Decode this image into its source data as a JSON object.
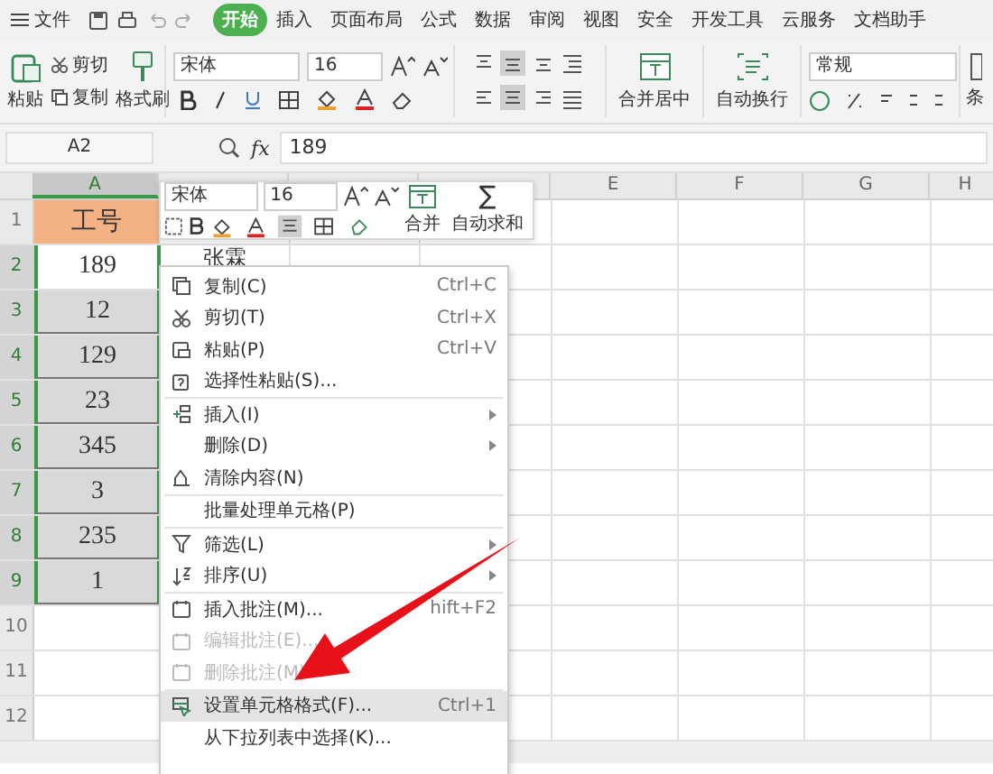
{
  "menu_bar": {
    "file": "文件",
    "tabs": [
      {
        "label": "开始",
        "selected": true
      },
      {
        "label": "插入",
        "selected": false
      },
      {
        "label": "页面布局",
        "selected": false
      },
      {
        "label": "公式",
        "selected": false
      },
      {
        "label": "数据",
        "selected": false
      },
      {
        "label": "审阅",
        "selected": false
      },
      {
        "label": "视图",
        "selected": false
      },
      {
        "label": "安全",
        "selected": false
      },
      {
        "label": "开发工具",
        "selected": false
      },
      {
        "label": "云服务",
        "selected": false
      },
      {
        "label": "文档助手",
        "selected": false
      }
    ]
  },
  "ribbon": {
    "paste": "粘贴",
    "cut": "剪切",
    "copy": "复制",
    "format_painter": "格式刷",
    "font": "宋体",
    "size": "16",
    "merge": "合并居中",
    "wrap": "自动换行",
    "number_format": "常规",
    "conditional": "条"
  },
  "formula_bar": {
    "cell_ref": "A2",
    "fx": "fx",
    "value": "189"
  },
  "sheet": {
    "columns": [
      {
        "label": "A",
        "selected": true
      },
      {
        "selected": false
      },
      {
        "selected": false
      },
      {
        "selected": false
      },
      {
        "label": "E",
        "selected": false
      },
      {
        "label": "F",
        "selected": false
      },
      {
        "label": "G",
        "selected": false
      },
      {
        "label": "H",
        "selected": false
      }
    ],
    "rows": [
      {
        "num": "1",
        "selected": false,
        "a": "工号",
        "kind": "header"
      },
      {
        "num": "2",
        "selected": true,
        "a": "189",
        "b": "张霖",
        "kind": "active"
      },
      {
        "num": "3",
        "selected": true,
        "a": "12",
        "kind": "range"
      },
      {
        "num": "4",
        "selected": true,
        "a": "129",
        "kind": "range"
      },
      {
        "num": "5",
        "selected": true,
        "a": "23",
        "kind": "range"
      },
      {
        "num": "6",
        "selected": true,
        "a": "345",
        "kind": "range"
      },
      {
        "num": "7",
        "selected": true,
        "a": "3",
        "kind": "range"
      },
      {
        "num": "8",
        "selected": true,
        "a": "235",
        "kind": "range"
      },
      {
        "num": "9",
        "selected": true,
        "a": "1",
        "kind": "range"
      },
      {
        "num": "10",
        "selected": false
      },
      {
        "num": "11",
        "selected": false
      },
      {
        "num": "12",
        "selected": false
      }
    ]
  },
  "mini_toolbar": {
    "font": "宋体",
    "size": "16",
    "merge": "合并",
    "sigma": "∑",
    "autosum": "自动求和"
  },
  "context_menu": [
    {
      "label": "复制(C)",
      "shortcut": "Ctrl+C",
      "kind": "copy",
      "disabled": false,
      "selected": false
    },
    {
      "label": "剪切(T)",
      "shortcut": "Ctrl+X",
      "kind": "cut",
      "disabled": false,
      "selected": false
    },
    {
      "label": "粘贴(P)",
      "shortcut": "Ctrl+V",
      "kind": "paste",
      "disabled": false,
      "selected": false
    },
    {
      "label": "选择性粘贴(S)...",
      "kind": "paste-special",
      "disabled": false,
      "selected": false,
      "separator": true
    },
    {
      "label": "插入(I)",
      "kind": "insert",
      "submenu": true,
      "disabled": false,
      "selected": false
    },
    {
      "label": "删除(D)",
      "submenu": true,
      "disabled": false,
      "selected": false
    },
    {
      "label": "清除内容(N)",
      "kind": "clear",
      "disabled": false,
      "selected": false,
      "separator": true
    },
    {
      "label": "批量处理单元格(P)",
      "disabled": false,
      "selected": false,
      "separator": true
    },
    {
      "label": "筛选(L)",
      "kind": "filter",
      "submenu": true,
      "disabled": false,
      "selected": false
    },
    {
      "label": "排序(U)",
      "kind": "sort",
      "submenu": true,
      "disabled": false,
      "selected": false,
      "separator": true
    },
    {
      "label": "插入批注(M)...",
      "shortcut": "hift+F2",
      "kind": "comment",
      "disabled": false,
      "selected": false
    },
    {
      "label": "编辑批注(E)...",
      "kind": "comment",
      "disabled": true,
      "selected": false
    },
    {
      "label": "删除批注(M)",
      "kind": "comment",
      "disabled": true,
      "selected": false,
      "separator": true
    },
    {
      "label": "设置单元格格式(F)...",
      "shortcut": "Ctrl+1",
      "kind": "format",
      "disabled": false,
      "selected": true
    },
    {
      "label": "从下拉列表中选择(K)...",
      "disabled": false,
      "selected": false
    }
  ]
}
